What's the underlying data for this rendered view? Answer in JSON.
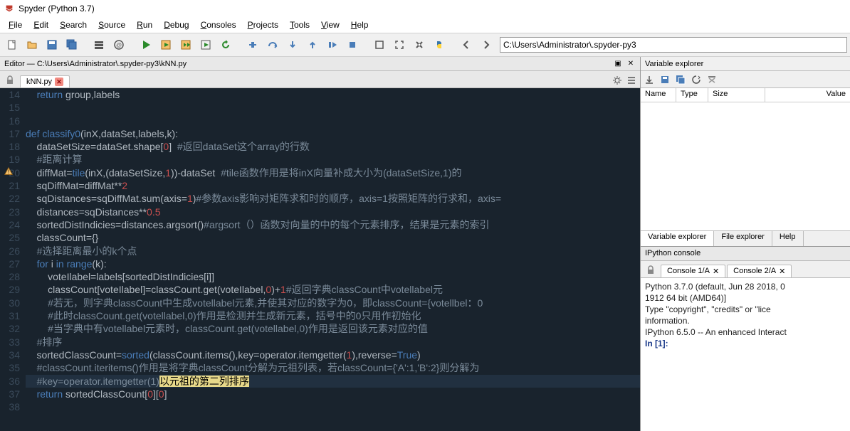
{
  "window": {
    "title": "Spyder (Python 3.7)"
  },
  "menu": {
    "items": [
      "File",
      "Edit",
      "Search",
      "Source",
      "Run",
      "Debug",
      "Consoles",
      "Projects",
      "Tools",
      "View",
      "Help"
    ]
  },
  "toolbar": {
    "path": "C:\\Users\\Administrator\\.spyder-py3"
  },
  "editor": {
    "title": "Editor — C:\\Users\\Administrator\\.spyder-py3\\kNN.py",
    "tab": "kNN.py",
    "lines": [
      {
        "n": 14,
        "html": "    <span class='kw'>return</span> group,labels"
      },
      {
        "n": 15,
        "html": ""
      },
      {
        "n": 16,
        "html": ""
      },
      {
        "n": 17,
        "html": "<span class='kw'>def</span> <span class='fn'>classify0</span>(inX,dataSet,labels,k):"
      },
      {
        "n": 18,
        "html": "    dataSetSize=dataSet.shape[<span class='num'>0</span>]  <span class='cm'>#返回dataSet这个array的行数</span>"
      },
      {
        "n": 19,
        "html": "    <span class='cm'>#距离计算</span>"
      },
      {
        "n": 20,
        "html": "    diffMat=<span class='fn'>tile</span>(inX,(dataSetSize,<span class='num'>1</span>))-dataSet  <span class='cm'>#tile函数作用是将inX向量补成大小为(dataSetSize,1)的</span>",
        "warn": true
      },
      {
        "n": 21,
        "html": "    sqDiffMat=diffMat**<span class='num'>2</span>"
      },
      {
        "n": 22,
        "html": "    sqDistances=sqDiffMat.sum(axis=<span class='num'>1</span>)<span class='cm'>#参数axis影响对矩阵求和时的顺序，axis=1按照矩阵的行求和，axis=</span>"
      },
      {
        "n": 23,
        "html": "    distances=sqDistances**<span class='num'>0.5</span>"
      },
      {
        "n": 24,
        "html": "    sortedDistIndicies=distances.argsort()<span class='cm'>#argsort（）函数对向量的中的每个元素排序，结果是元素的索引</span>"
      },
      {
        "n": 25,
        "html": "    classCount={}"
      },
      {
        "n": 26,
        "html": "    <span class='cm'>#选择距离最小的k个点</span>"
      },
      {
        "n": 27,
        "html": "    <span class='kw'>for</span> i <span class='kw'>in</span> <span class='fn'>range</span>(k):"
      },
      {
        "n": 28,
        "html": "        voteIlabel=labels[sortedDistIndicies[i]]"
      },
      {
        "n": 29,
        "html": "        classCount[voteIlabel]=classCount.get(voteIlabel,<span class='num'>0</span>)+<span class='num'>1</span><span class='cm'>#返回字典classCount中votellabel元</span>"
      },
      {
        "n": 30,
        "html": "        <span class='cm'>#若无，则字典classCount中生成votellabel元素,并使其对应的数字为0，即classCount={votellbel：0</span>"
      },
      {
        "n": 31,
        "html": "        <span class='cm'>#此时classCount.get(votellabel,0)作用是检测并生成新元素，括号中的0只用作初始化</span>"
      },
      {
        "n": 32,
        "html": "        <span class='cm'>#当字典中有votellabel元素时，classCount.get(votellabel,0)作用是返回该元素对应的值</span>"
      },
      {
        "n": 33,
        "html": "    <span class='cm'>#排序</span>"
      },
      {
        "n": 34,
        "html": "    sortedClassCount=<span class='fn'>sorted</span>(classCount.items(),key=operator.itemgetter(<span class='num'>1</span>),reverse=<span class='bool'>True</span>)"
      },
      {
        "n": 35,
        "html": "    <span class='cm'>#classCount.iteritems()作用是将字典classCount分解为元祖列表，若classCount={'A':1,'B':2}则分解为</span>"
      },
      {
        "n": 36,
        "html": "    <span class='cm'>#key=operator.itemgetter(1)</span><span class='hi'>以元祖的第二列排序</span>",
        "current": true
      },
      {
        "n": 37,
        "html": "    <span class='kw'>return</span> sortedClassCount[<span class='num'>0</span>][<span class='num'>0</span>]"
      },
      {
        "n": 38,
        "html": ""
      }
    ]
  },
  "varexp": {
    "title": "Variable explorer",
    "cols": [
      "Name",
      "Type",
      "Size",
      "Value"
    ],
    "tabs": [
      "Variable explorer",
      "File explorer",
      "Help"
    ]
  },
  "ipython": {
    "title": "IPython console",
    "tabs": [
      "Console 1/A",
      "Console 2/A"
    ],
    "active_tab": 1,
    "lines": [
      "Python 3.7.0 (default, Jun 28 2018, 0",
      "1912 64 bit (AMD64)]",
      "Type \"copyright\", \"credits\" or \"lice",
      "information.",
      "",
      "IPython 6.5.0 -- An enhanced Interact",
      ""
    ],
    "prompt": "In [1]:"
  }
}
